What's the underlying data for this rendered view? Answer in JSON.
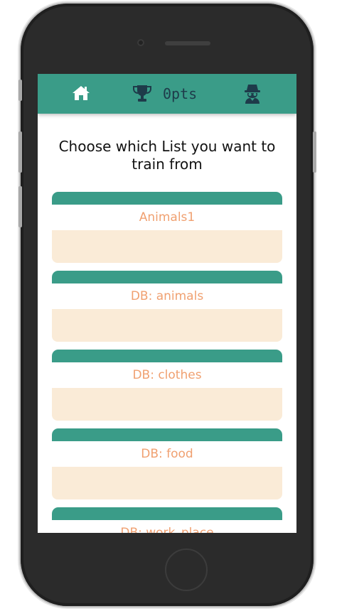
{
  "header": {
    "points": "0pts",
    "icons": [
      "home-icon",
      "trophy-icon",
      "spy-icon"
    ]
  },
  "heading": "Choose which List you want to train from",
  "lists": [
    {
      "name": "Animals1"
    },
    {
      "name": "DB: animals"
    },
    {
      "name": "DB: clothes"
    },
    {
      "name": "DB: food"
    },
    {
      "name": "DB: work_place"
    }
  ],
  "colors": {
    "accent": "#3a9c88",
    "label": "#f0a070",
    "card_body": "#faebd7",
    "icon": "#ffffff",
    "dark_icon": "#1e3b4a"
  }
}
